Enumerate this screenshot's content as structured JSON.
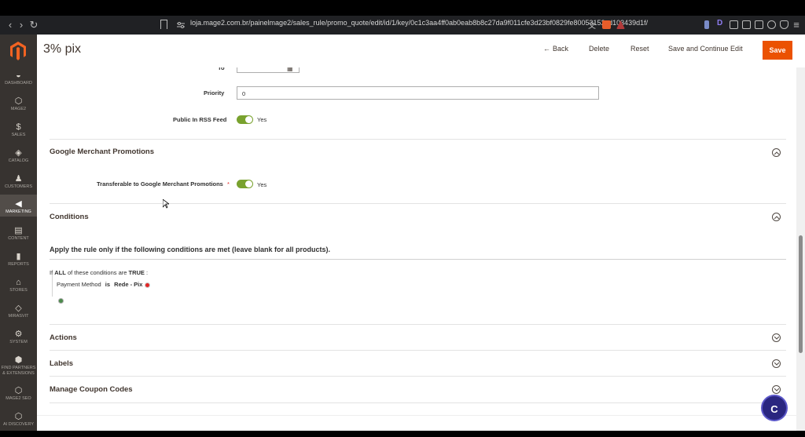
{
  "browser": {
    "url": "loja.mage2.com.br/painelmage2/sales_rule/promo_quote/edit/id/1/key/0c1c3aa4ff0ab0eab8b8c27da9f011cfe3d23bf0829fe80053152cd103439d1f/"
  },
  "sidebar": {
    "items": [
      {
        "label": "DASHBOARD",
        "icon": "dashboard-icon"
      },
      {
        "label": "MAGE2",
        "icon": "hexagon-icon"
      },
      {
        "label": "SALES",
        "icon": "dollar-icon"
      },
      {
        "label": "CATALOG",
        "icon": "box-icon"
      },
      {
        "label": "CUSTOMERS",
        "icon": "person-icon"
      },
      {
        "label": "MARKETING",
        "icon": "megaphone-icon"
      },
      {
        "label": "CONTENT",
        "icon": "layout-icon"
      },
      {
        "label": "REPORTS",
        "icon": "bar-chart-icon"
      },
      {
        "label": "STORES",
        "icon": "store-icon"
      },
      {
        "label": "MIRASVIT",
        "icon": "diamond-icon"
      },
      {
        "label": "SYSTEM",
        "icon": "gear-icon"
      },
      {
        "label": "FIND PARTNERS & EXTENSIONS",
        "icon": "extensions-icon"
      },
      {
        "label": "MAGE2 SEO",
        "icon": "hexagon-icon"
      },
      {
        "label": "AI DISCOVERY",
        "icon": "hexagon-icon"
      }
    ]
  },
  "header": {
    "title": "3% pix",
    "back": "Back",
    "delete": "Delete",
    "reset": "Reset",
    "save_continue": "Save and Continue Edit",
    "save": "Save"
  },
  "form": {
    "to_label": "To",
    "priority_label": "Priority",
    "priority_value": "0",
    "rss_label": "Public In RSS Feed",
    "rss_value": "Yes"
  },
  "sections": {
    "google": {
      "title": "Google Merchant Promotions",
      "field_label": "Transferable to Google Merchant Promotions",
      "required_mark": "*",
      "value": "Yes"
    },
    "conditions": {
      "title": "Conditions",
      "heading": "Apply the rule only if the following conditions are met (leave blank for all products).",
      "if_text": "If",
      "all_text": "ALL",
      "of_these_text": "of these conditions are",
      "true_text": "TRUE",
      "colon": ":",
      "cond_attr": "Payment Method",
      "cond_op": "is",
      "cond_value": "Rede - Pix"
    },
    "actions": {
      "title": "Actions"
    },
    "labels": {
      "title": "Labels"
    },
    "coupons": {
      "title": "Manage Coupon Codes"
    }
  },
  "chat": {
    "label": "C"
  },
  "colors": {
    "accent": "#eb5202",
    "toggle_on": "#79a22e",
    "sidebar": "#373330"
  }
}
